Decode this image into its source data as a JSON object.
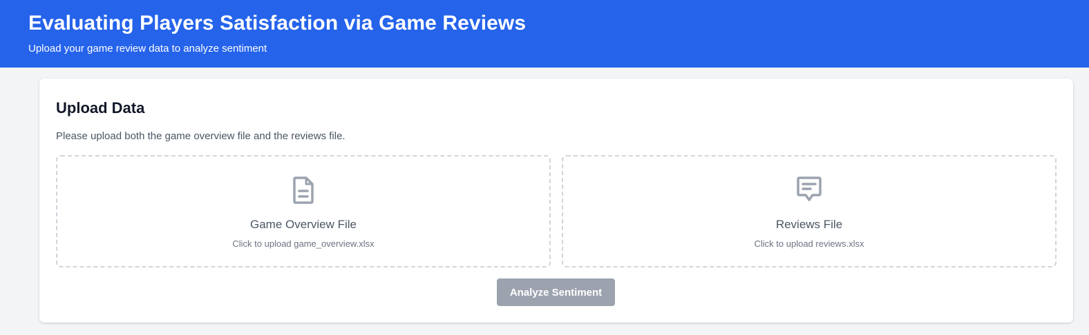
{
  "header": {
    "title": "Evaluating Players Satisfaction via Game Reviews",
    "subtitle": "Upload your game review data to analyze sentiment",
    "background_color": "#2563eb"
  },
  "upload": {
    "heading": "Upload Data",
    "description": "Please upload both the game overview file and the reviews file.",
    "dropzones": [
      {
        "icon": "document-icon",
        "title": "Game Overview File",
        "hint": "Click to upload game_overview.xlsx"
      },
      {
        "icon": "comment-icon",
        "title": "Reviews File",
        "hint": "Click to upload reviews.xlsx"
      }
    ],
    "analyze_button": {
      "label": "Analyze Sentiment",
      "state": "disabled",
      "color": "#9ca3af"
    }
  }
}
